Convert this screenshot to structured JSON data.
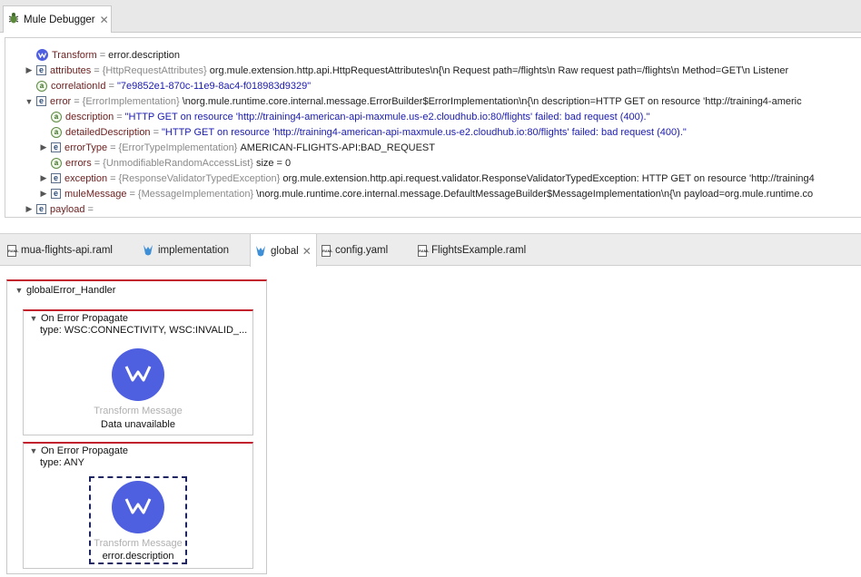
{
  "debugger": {
    "tab_label": "Mule Debugger",
    "close_glyph": "✕",
    "rows": [
      {
        "name": "Transform",
        "eq": "=",
        "type": "",
        "value": "error.description",
        "value_kind": "plain"
      },
      {
        "name": "attributes",
        "eq": "=",
        "type": "{HttpRequestAttributes}",
        "value": "org.mule.extension.http.api.HttpRequestAttributes\\n{\\n   Request path=/flights\\n   Raw request path=/flights\\n   Method=GET\\n   Listener",
        "value_kind": "plain"
      },
      {
        "name": "correlationId",
        "eq": "=",
        "type": "",
        "value": "\"7e9852e1-870c-11e9-8ac4-f018983d9329\"",
        "value_kind": "string"
      },
      {
        "name": "error",
        "eq": "=",
        "type": "{ErrorImplementation}",
        "value": "\\norg.mule.runtime.core.internal.message.ErrorBuilder$ErrorImplementation\\n{\\n  description=HTTP GET on resource 'http://training4-americ",
        "value_kind": "plain"
      },
      {
        "name": "description",
        "eq": "=",
        "type": "",
        "value": "\"HTTP GET on resource 'http://training4-american-api-maxmule.us-e2.cloudhub.io:80/flights' failed: bad request (400).\"",
        "value_kind": "string"
      },
      {
        "name": "detailedDescription",
        "eq": "=",
        "type": "",
        "value": "\"HTTP GET on resource 'http://training4-american-api-maxmule.us-e2.cloudhub.io:80/flights' failed: bad request (400).\"",
        "value_kind": "string"
      },
      {
        "name": "errorType",
        "eq": "=",
        "type": "{ErrorTypeImplementation}",
        "value": "AMERICAN-FLIGHTS-API:BAD_REQUEST",
        "value_kind": "plain"
      },
      {
        "name": "errors",
        "eq": "=",
        "type": "{UnmodifiableRandomAccessList}",
        "value": "size = 0",
        "value_kind": "plain"
      },
      {
        "name": "exception",
        "eq": "=",
        "type": "{ResponseValidatorTypedException}",
        "value": "org.mule.extension.http.api.request.validator.ResponseValidatorTypedException: HTTP GET on resource 'http://training4",
        "value_kind": "plain"
      },
      {
        "name": "muleMessage",
        "eq": "=",
        "type": "{MessageImplementation}",
        "value": "\\norg.mule.runtime.core.internal.message.DefaultMessageBuilder$MessageImplementation\\n{\\n  payload=org.mule.runtime.co",
        "value_kind": "plain"
      },
      {
        "name": "payload",
        "eq": "=",
        "type": "",
        "value": "",
        "value_kind": "plain"
      }
    ]
  },
  "editor": {
    "tabs": [
      {
        "label": "mua-flights-api.raml",
        "icon": "raml-file-icon"
      },
      {
        "label": "implementation",
        "icon": "mule-config-icon"
      },
      {
        "label": "global",
        "icon": "mule-config-icon",
        "active": true
      },
      {
        "label": "config.yaml",
        "icon": "raml-file-icon"
      },
      {
        "label": "FlightsExample.raml",
        "icon": "raml-file-icon"
      }
    ],
    "raml_icon_text": "RAML"
  },
  "canvas": {
    "handler_title": "globalError_Handler",
    "scopes": [
      {
        "title": "On Error Propagate",
        "type": "type: WSC:CONNECTIVITY, WSC:INVALID_...",
        "component": "Transform Message",
        "component_sub": "Data unavailable"
      },
      {
        "title": "On Error Propagate",
        "type": "type: ANY",
        "component": "Transform Message",
        "component_sub": "error.description"
      }
    ]
  },
  "colors": {
    "accent": "#4e5fe0",
    "scope_border": "#c3202e"
  }
}
